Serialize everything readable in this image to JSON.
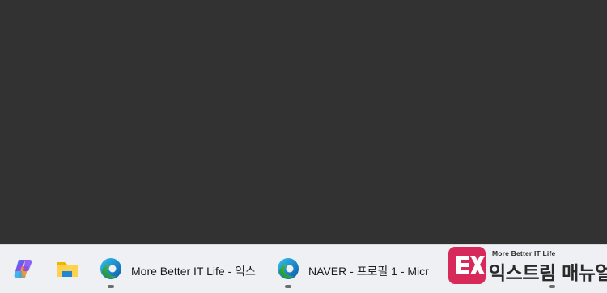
{
  "taskbar": {
    "items": [
      {
        "name": "copilot",
        "icon": "copilot-icon"
      },
      {
        "name": "file-explorer",
        "icon": "folder-icon"
      },
      {
        "name": "edge-window-1",
        "icon": "edge-icon",
        "label": "More Better IT Life - 익스"
      },
      {
        "name": "edge-window-2",
        "icon": "edge-icon",
        "label": "NAVER - 프로필 1 - Micr"
      }
    ]
  },
  "watermark": {
    "subtitle": "More Better IT Life",
    "title": "익스트림 매뉴얼"
  },
  "colors": {
    "desktop": "#323232",
    "taskbar": "#eef0f4",
    "logo": "#d82a5a"
  }
}
